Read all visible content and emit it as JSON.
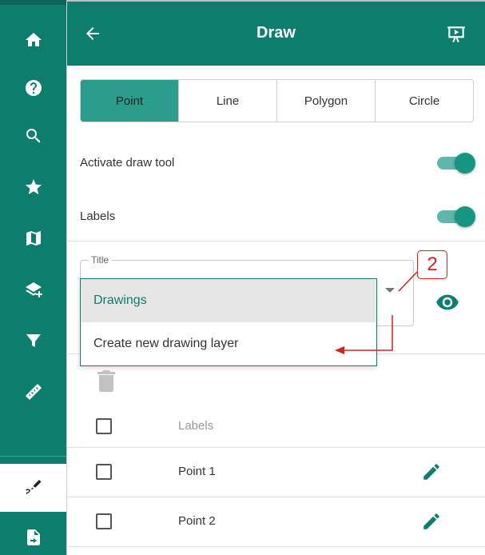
{
  "sidebar": {
    "items": [
      {
        "name": "home",
        "icon": "home-icon"
      },
      {
        "name": "help",
        "icon": "help-icon"
      },
      {
        "name": "search",
        "icon": "search-icon"
      },
      {
        "name": "favorites",
        "icon": "star-icon"
      },
      {
        "name": "map",
        "icon": "map-icon"
      },
      {
        "name": "add-layer",
        "icon": "layers-plus-icon"
      },
      {
        "name": "filter",
        "icon": "filter-icon"
      },
      {
        "name": "measure",
        "icon": "ruler-icon"
      },
      {
        "name": "draw",
        "icon": "draw-icon",
        "active": true
      },
      {
        "name": "export",
        "icon": "file-export-icon"
      }
    ]
  },
  "header": {
    "title": "Draw",
    "back_icon": "arrow-left-icon",
    "present_icon": "presentation-icon"
  },
  "tabs": [
    {
      "label": "Point",
      "active": true
    },
    {
      "label": "Line",
      "active": false
    },
    {
      "label": "Polygon",
      "active": false
    },
    {
      "label": "Circle",
      "active": false
    }
  ],
  "settings": {
    "activate_label": "Activate draw tool",
    "activate_on": true,
    "labels_label": "Labels",
    "labels_on": true
  },
  "title_field": {
    "label": "Title",
    "selected": "Drawings",
    "options": [
      "Drawings",
      "Create new drawing layer"
    ]
  },
  "annotation": {
    "callout_number": "2"
  },
  "table": {
    "header_label": "Labels",
    "rows": [
      {
        "label": "Point 1",
        "checked": false
      },
      {
        "label": "Point 2",
        "checked": false
      }
    ]
  },
  "colors": {
    "primary": "#0d7d6e",
    "active_tab": "#2a9d8f",
    "annotation": "#d62020"
  }
}
